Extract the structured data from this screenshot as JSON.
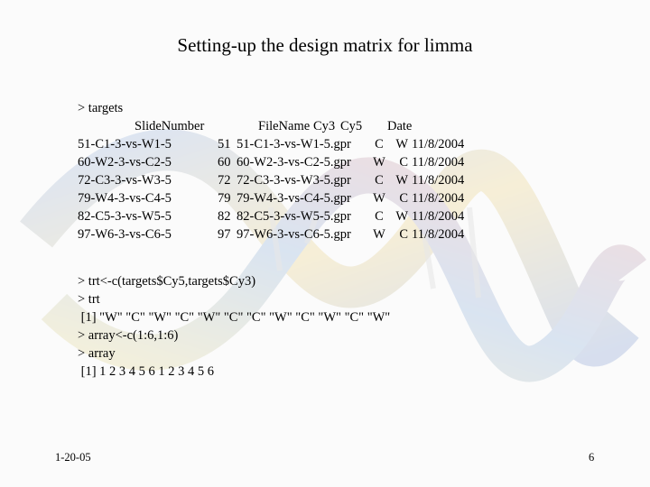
{
  "slide": {
    "title": "Setting-up the design matrix for limma",
    "footer_date": "1-20-05",
    "page_number": "6"
  },
  "console": {
    "cmd_targets": "> targets",
    "table": {
      "columns": [
        "SlideNumber",
        "FileName",
        "Cy3",
        "Cy5",
        "Date"
      ],
      "rows": [
        {
          "name": "51-C1-3-vs-W1-5",
          "slide_number": "51",
          "file_name": "51-C1-3-vs-W1-5.gpr",
          "cy3": "C",
          "cy5": "W",
          "date": "11/8/2004"
        },
        {
          "name": "60-W2-3-vs-C2-5",
          "slide_number": "60",
          "file_name": "60-W2-3-vs-C2-5.gpr",
          "cy3": "W",
          "cy5": "C",
          "date": "11/8/2004"
        },
        {
          "name": "72-C3-3-vs-W3-5",
          "slide_number": "72",
          "file_name": "72-C3-3-vs-W3-5.gpr",
          "cy3": "C",
          "cy5": "W",
          "date": "11/8/2004"
        },
        {
          "name": "79-W4-3-vs-C4-5",
          "slide_number": "79",
          "file_name": "79-W4-3-vs-C4-5.gpr",
          "cy3": "W",
          "cy5": "C",
          "date": "11/8/2004"
        },
        {
          "name": "82-C5-3-vs-W5-5",
          "slide_number": "82",
          "file_name": "82-C5-3-vs-W5-5.gpr",
          "cy3": "C",
          "cy5": "W",
          "date": "11/8/2004"
        },
        {
          "name": "97-W6-3-vs-C6-5",
          "slide_number": "97",
          "file_name": "97-W6-3-vs-C6-5.gpr",
          "cy3": "W",
          "cy5": "C",
          "date": "11/8/2004"
        }
      ]
    },
    "lines2": [
      "> trt<-c(targets$Cy5,targets$Cy3)",
      "> trt",
      " [1] \"W\" \"C\" \"W\" \"C\" \"W\" \"C\" \"C\" \"W\" \"C\" \"W\" \"C\" \"W\"",
      "> array<-c(1:6,1:6)",
      "> array",
      " [1] 1 2 3 4 5 6 1 2 3 4 5 6"
    ]
  }
}
